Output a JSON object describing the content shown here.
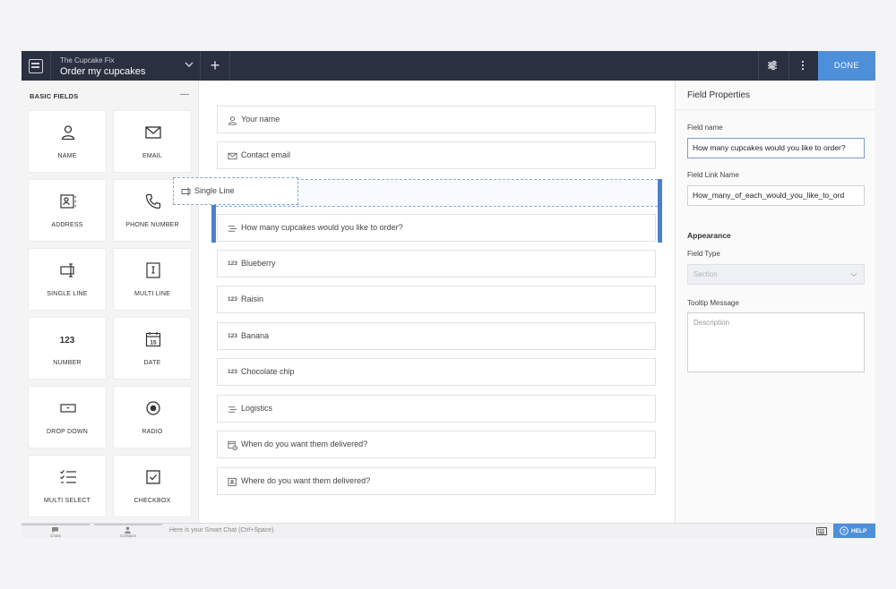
{
  "header": {
    "app_name": "The Cupcake Fix",
    "form_title": "Order my cupcakes",
    "add_label": "+",
    "done_label": "DONE"
  },
  "left_panel": {
    "title": "BASIC FIELDS",
    "collapse_label": "—",
    "tiles": [
      {
        "label": "NAME",
        "icon": "person-icon"
      },
      {
        "label": "EMAIL",
        "icon": "envelope-icon"
      },
      {
        "label": "ADDRESS",
        "icon": "address-card-icon"
      },
      {
        "label": "PHONE NUMBER",
        "icon": "phone-icon"
      },
      {
        "label": "SINGLE LINE",
        "icon": "single-line-icon"
      },
      {
        "label": "MULTI LINE",
        "icon": "multi-line-icon"
      },
      {
        "label": "NUMBER",
        "icon": "number-icon",
        "glyph": "123"
      },
      {
        "label": "DATE",
        "icon": "calendar-icon",
        "glyph": "15"
      },
      {
        "label": "DROP DOWN",
        "icon": "dropdown-icon"
      },
      {
        "label": "RADIO",
        "icon": "radio-icon"
      },
      {
        "label": "MULTI SELECT",
        "icon": "multi-select-icon"
      },
      {
        "label": "CHECKBOX",
        "icon": "checkbox-icon"
      }
    ]
  },
  "drag_ghost": {
    "label": "Single Line"
  },
  "canvas": {
    "fields": [
      {
        "label": "Your name",
        "icon": "person-icon"
      },
      {
        "label": "Contact email",
        "icon": "envelope-icon"
      },
      {
        "label": "How many cupcakes would you like to order?",
        "icon": "section-icon",
        "selected": true
      },
      {
        "label": "Blueberry",
        "icon": "number-icon",
        "glyph": "123"
      },
      {
        "label": "Raisin",
        "icon": "number-icon",
        "glyph": "123"
      },
      {
        "label": "Banana",
        "icon": "number-icon",
        "glyph": "123"
      },
      {
        "label": "Chocolate chip",
        "icon": "number-icon",
        "glyph": "123"
      },
      {
        "label": "Logistics",
        "icon": "section-icon"
      },
      {
        "label": "When do you want them delivered?",
        "icon": "datetime-icon"
      },
      {
        "label": "Where do you want them delivered?",
        "icon": "address-icon"
      }
    ]
  },
  "properties": {
    "title": "Field Properties",
    "field_name_label": "Field name",
    "field_name_value": "How many cupcakes would you like to order?",
    "link_name_label": "Field Link Name",
    "link_name_value": "How_many_of_each_would_you_like_to_ord",
    "appearance_label": "Appearance",
    "field_type_label": "Field Type",
    "field_type_value": "Section",
    "tooltip_label": "Tooltip Message",
    "tooltip_placeholder": "Description"
  },
  "bottom": {
    "chats_label": "Chats",
    "contacts_label": "Contacts",
    "smart_chat_placeholder": "Here is your Smart Chat (Ctrl+Space)",
    "help_label": "HELP"
  },
  "colors": {
    "topbar": "#2b3040",
    "accent": "#4d8fd9",
    "selection": "#4d7fc9"
  }
}
